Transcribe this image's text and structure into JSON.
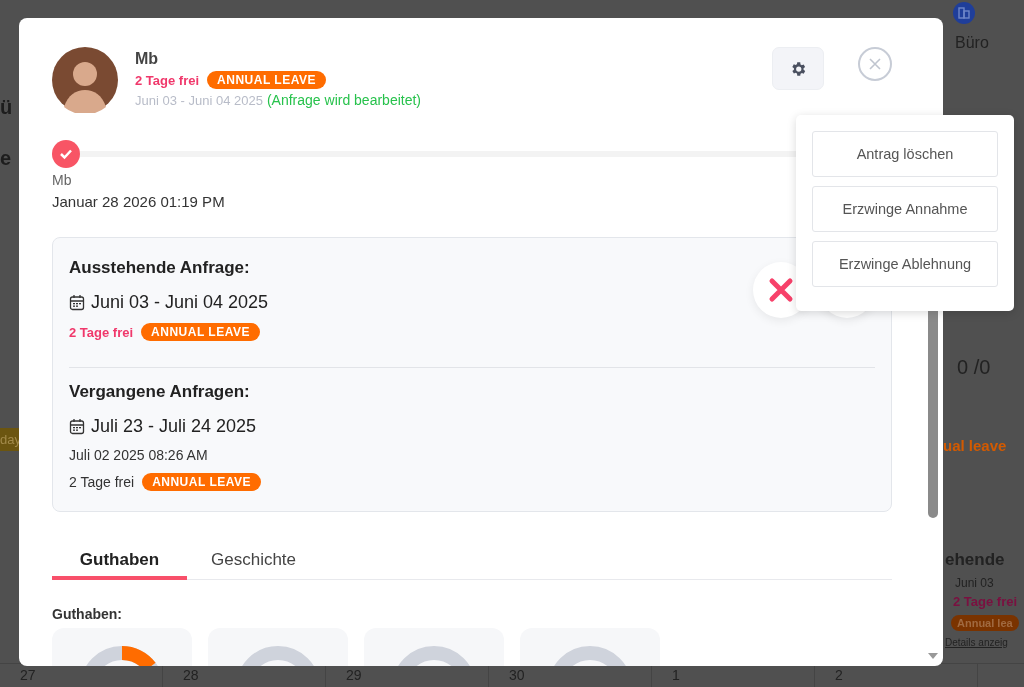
{
  "background": {
    "left_texts": [
      "ü",
      "e"
    ],
    "left_badge": "day",
    "side": {
      "office": "Büro",
      "ratio": "0 /0",
      "leave": "ual leave",
      "pending": "ehende",
      "date": "Juni 03",
      "days": "2 Tage frei",
      "badge": "Annual lea",
      "link": "Details anzeig"
    },
    "calendar_days": [
      "27",
      "28",
      "29",
      "30",
      "1",
      "2"
    ]
  },
  "dialog": {
    "header": {
      "name": "Mb",
      "days": "2 Tage frei",
      "leave_type": "ANNUAL LEAVE",
      "dates": "Juni 03 - Juni 04 2025",
      "status": "(Anfrage wird bearbeitet)"
    },
    "timeline": [
      {
        "name": "Mb",
        "time": "Januar 28 2026 01:19 PM",
        "done": true
      }
    ],
    "pending": {
      "title": "Ausstehende Anfrage:",
      "dates": "Juni 03 - Juni 04 2025",
      "days": "2 Tage frei",
      "leave_type": "ANNUAL LEAVE"
    },
    "past": {
      "title": "Vergangene Anfragen:",
      "items": [
        {
          "dates": "Juli 23 - Juli 24 2025",
          "submitted": "Juli 02 2025 08:26 AM",
          "days": "2 Tage frei",
          "leave_type": "ANNUAL LEAVE"
        }
      ]
    },
    "tabs": [
      {
        "label": "Guthaben",
        "selected": true
      },
      {
        "label": "Geschichte",
        "selected": false
      }
    ],
    "balance": {
      "title": "Guthaben:",
      "cards": [
        {
          "kind": "used"
        },
        {
          "kind": "empty"
        },
        {
          "kind": "empty"
        },
        {
          "kind": "empty"
        }
      ]
    }
  },
  "menu": {
    "items": [
      "Antrag löschen",
      "Erzwinge Annahme",
      "Erzwinge Ablehnung"
    ]
  }
}
